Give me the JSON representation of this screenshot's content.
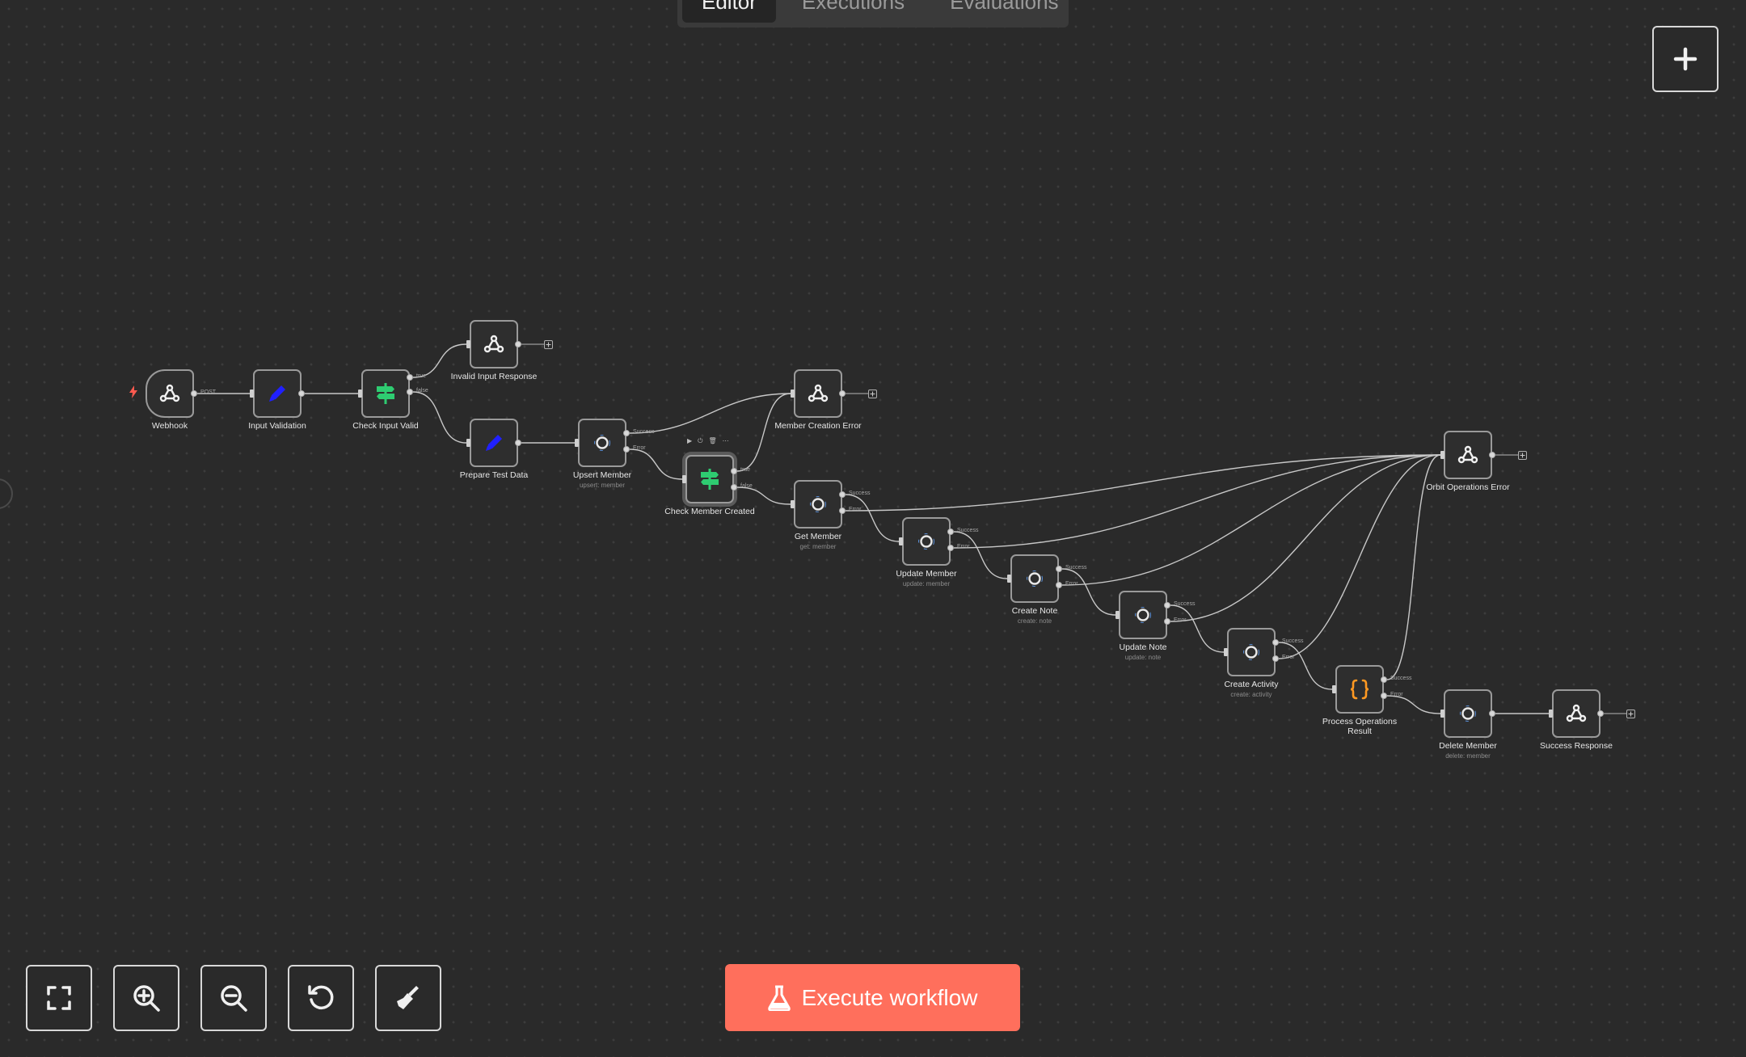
{
  "tabs": [
    {
      "label": "Editor",
      "active": true
    },
    {
      "label": "Executions",
      "active": false
    },
    {
      "label": "Evaluations",
      "active": false
    }
  ],
  "colors": {
    "canvas": "#2a2a2a",
    "node_border": "#9a9a9a",
    "edge": "#c8c8c8",
    "if_icon": "#2ecc71",
    "set_icon": "#2020ff",
    "code_icon": "#ff9922",
    "execute_button": "#ff6f5c"
  },
  "nodes": [
    {
      "id": "webhook",
      "label": "Webhook",
      "subtitle": "",
      "icon": "webhook-icon",
      "trigger": true
    },
    {
      "id": "input_validation",
      "label": "Input Validation",
      "subtitle": "",
      "icon": "pencil-icon"
    },
    {
      "id": "check_input_valid",
      "label": "Check Input Valid",
      "subtitle": "",
      "icon": "if-signpost-icon"
    },
    {
      "id": "invalid_input_response",
      "label": "Invalid Input Response",
      "subtitle": "",
      "icon": "webhook-icon"
    },
    {
      "id": "prepare_test_data",
      "label": "Prepare Test Data",
      "subtitle": "",
      "icon": "pencil-icon"
    },
    {
      "id": "upsert_member",
      "label": "Upsert Member",
      "subtitle": "upsert: member",
      "icon": "orbit-icon"
    },
    {
      "id": "check_member_created",
      "label": "Check Member Created",
      "subtitle": "",
      "icon": "if-signpost-icon",
      "selected": true
    },
    {
      "id": "member_creation_error",
      "label": "Member Creation Error",
      "subtitle": "",
      "icon": "webhook-icon"
    },
    {
      "id": "get_member",
      "label": "Get Member",
      "subtitle": "get: member",
      "icon": "orbit-icon"
    },
    {
      "id": "update_member",
      "label": "Update Member",
      "subtitle": "update: member",
      "icon": "orbit-icon"
    },
    {
      "id": "create_note",
      "label": "Create Note",
      "subtitle": "create: note",
      "icon": "orbit-icon"
    },
    {
      "id": "update_note",
      "label": "Update Note",
      "subtitle": "update: note",
      "icon": "orbit-icon"
    },
    {
      "id": "create_activity",
      "label": "Create Activity",
      "subtitle": "create: activity",
      "icon": "orbit-icon"
    },
    {
      "id": "process_operations_result",
      "label": "Process Operations Result",
      "subtitle": "",
      "icon": "code-braces-icon"
    },
    {
      "id": "orbit_operations_error",
      "label": "Orbit Operations Error",
      "subtitle": "",
      "icon": "webhook-icon"
    },
    {
      "id": "delete_member",
      "label": "Delete Member",
      "subtitle": "delete: member",
      "icon": "orbit-icon"
    },
    {
      "id": "success_response",
      "label": "Success Response",
      "subtitle": "",
      "icon": "webhook-icon"
    }
  ],
  "connections": [
    {
      "from": "webhook",
      "to": "input_validation",
      "label": "POST"
    },
    {
      "from": "input_validation",
      "to": "check_input_valid",
      "label": ""
    },
    {
      "from": "check_input_valid",
      "to": "invalid_input_response",
      "label": "true"
    },
    {
      "from": "check_input_valid",
      "to": "prepare_test_data",
      "label": "false"
    },
    {
      "from": "prepare_test_data",
      "to": "upsert_member",
      "label": ""
    },
    {
      "from": "upsert_member",
      "to": "member_creation_error",
      "label": "Success"
    },
    {
      "from": "upsert_member",
      "to": "check_member_created",
      "label": "Error"
    },
    {
      "from": "check_member_created",
      "to": "member_creation_error",
      "label": "true"
    },
    {
      "from": "check_member_created",
      "to": "get_member",
      "label": "false"
    },
    {
      "from": "get_member",
      "to": "update_member",
      "label": "Success"
    },
    {
      "from": "get_member",
      "to": "orbit_operations_error",
      "label": "Error"
    },
    {
      "from": "update_member",
      "to": "create_note",
      "label": "Success"
    },
    {
      "from": "update_member",
      "to": "orbit_operations_error",
      "label": "Error"
    },
    {
      "from": "create_note",
      "to": "update_note",
      "label": "Success"
    },
    {
      "from": "create_note",
      "to": "orbit_operations_error",
      "label": "Error"
    },
    {
      "from": "update_note",
      "to": "create_activity",
      "label": "Success"
    },
    {
      "from": "update_note",
      "to": "orbit_operations_error",
      "label": "Error"
    },
    {
      "from": "create_activity",
      "to": "process_operations_result",
      "label": "Success"
    },
    {
      "from": "create_activity",
      "to": "orbit_operations_error",
      "label": "Error"
    },
    {
      "from": "process_operations_result",
      "to": "orbit_operations_error",
      "label": "Success"
    },
    {
      "from": "process_operations_result",
      "to": "delete_member",
      "label": "Error"
    },
    {
      "from": "delete_member",
      "to": "success_response",
      "label": ""
    }
  ],
  "node_toolbar": [
    "▶",
    "⏻",
    "🗑",
    "⋯"
  ],
  "controls": [
    {
      "name": "zoom-to-fit-button",
      "icon": "fit-view-icon"
    },
    {
      "name": "zoom-in-button",
      "icon": "zoom-in-icon"
    },
    {
      "name": "zoom-out-button",
      "icon": "zoom-out-icon"
    },
    {
      "name": "reset-zoom-button",
      "icon": "undo-icon"
    },
    {
      "name": "tidy-up-button",
      "icon": "broom-icon"
    }
  ],
  "execute_button": {
    "label": "Execute workflow",
    "icon": "flask-icon"
  }
}
